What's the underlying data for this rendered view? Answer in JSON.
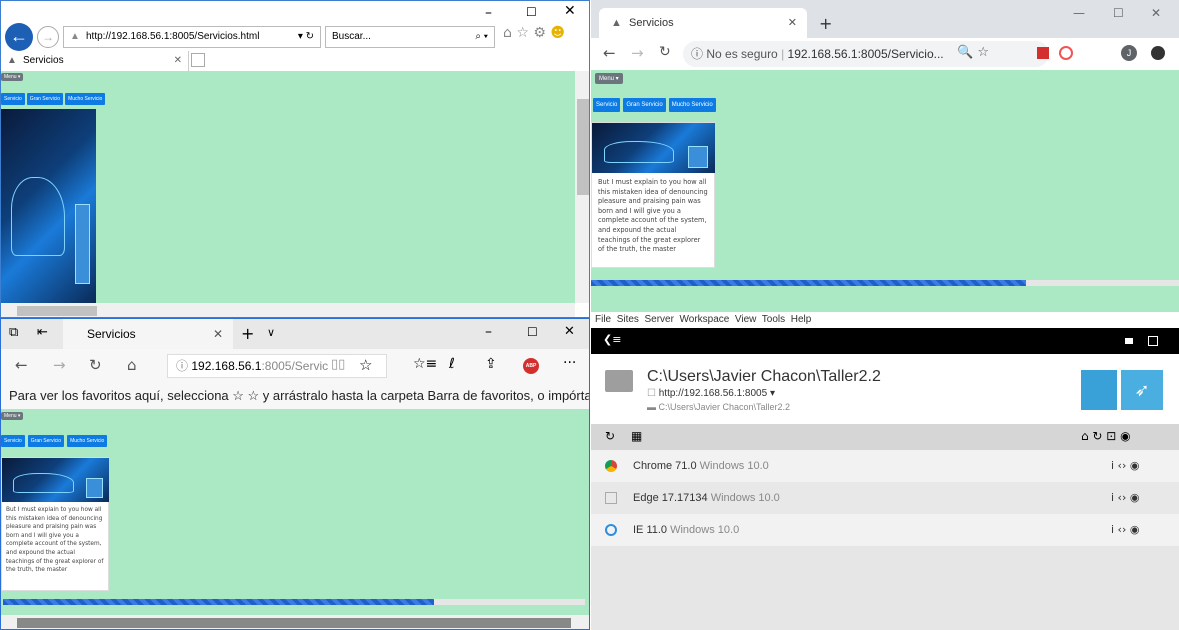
{
  "ie": {
    "url": "http://192.168.56.1:8005/Servicios.html",
    "search_placeholder": "Buscar...",
    "tab_title": "Servicios"
  },
  "chrome": {
    "tab_title": "Servicios",
    "security": "No es seguro",
    "url": "192.168.56.1:8005/Servicio..."
  },
  "edge": {
    "tab_title": "Servicios",
    "url_host": "192.168.56.1",
    "url_path": ":8005/Servic",
    "favorites_hint": "Para ver los favoritos aquí, selecciona ☆ ☆ y arrástralo hasta la carpeta Barra de favoritos, o impórtalo"
  },
  "page": {
    "menu_label": "Menu ▾",
    "pills": [
      "Servicio",
      "Gran Servicio",
      "Mucho Servicio"
    ],
    "card_text": "But I must explain to you how all this mistaken idea of denouncing pleasure and praising pain was born and I will give you a complete account of the system, and expound the actual teachings of the great explorer of the truth, the master",
    "progress_chrome": 0.74,
    "progress_edge": 0.74
  },
  "tool": {
    "menu": [
      "File",
      "Sites",
      "Server",
      "Workspace",
      "View",
      "Tools",
      "Help"
    ],
    "project_path": "C:\\Users\\Javier Chacon\\Taller2.2",
    "project_url": "http://192.168.56.1:8005",
    "project_subpath": "C:\\Users\\Javier Chacon\\Taller2.2",
    "browsers": [
      {
        "name": "Chrome 71.0",
        "os": "Windows 10.0"
      },
      {
        "name": "Edge 17.17134",
        "os": "Windows 10.0"
      },
      {
        "name": "IE 11.0",
        "os": "Windows 10.0"
      }
    ]
  }
}
